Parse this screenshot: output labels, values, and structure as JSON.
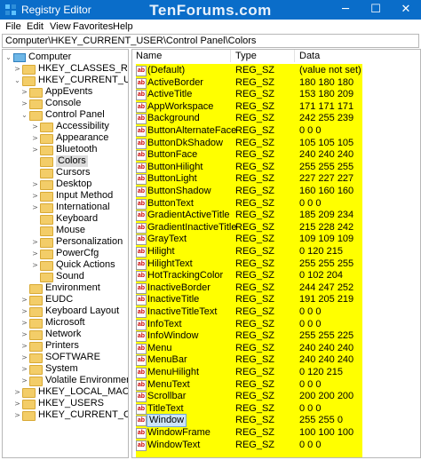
{
  "window": {
    "title": "Registry Editor",
    "watermark": "TenForums.com",
    "controls": {
      "minimize": "─",
      "maximize": "☐",
      "close": "✕"
    }
  },
  "menu": [
    "File",
    "Edit",
    "View",
    "Favorites",
    "Help"
  ],
  "address": "Computer\\HKEY_CURRENT_USER\\Control Panel\\Colors",
  "tree": [
    {
      "label": "Computer",
      "expander": "⌄",
      "icon": "computer"
    },
    {
      "label": "HKEY_CLASSES_ROOT",
      "expander": ">",
      "icon": "folder"
    },
    {
      "label": "HKEY_CURRENT_USER",
      "expander": "⌄",
      "icon": "folder"
    },
    {
      "label": "AppEvents",
      "expander": ">",
      "icon": "folder"
    },
    {
      "label": "Console",
      "expander": ">",
      "icon": "folder"
    },
    {
      "label": "Control Panel",
      "expander": "⌄",
      "icon": "folder"
    },
    {
      "label": "Accessibility",
      "expander": ">",
      "icon": "folder"
    },
    {
      "label": "Appearance",
      "expander": ">",
      "icon": "folder"
    },
    {
      "label": "Bluetooth",
      "expander": ">",
      "icon": "folder"
    },
    {
      "label": "Colors",
      "expander": "",
      "icon": "folder",
      "selected": true
    },
    {
      "label": "Cursors",
      "expander": "",
      "icon": "folder"
    },
    {
      "label": "Desktop",
      "expander": ">",
      "icon": "folder"
    },
    {
      "label": "Input Method",
      "expander": ">",
      "icon": "folder"
    },
    {
      "label": "International",
      "expander": ">",
      "icon": "folder"
    },
    {
      "label": "Keyboard",
      "expander": "",
      "icon": "folder"
    },
    {
      "label": "Mouse",
      "expander": "",
      "icon": "folder"
    },
    {
      "label": "Personalization",
      "expander": ">",
      "icon": "folder"
    },
    {
      "label": "PowerCfg",
      "expander": ">",
      "icon": "folder"
    },
    {
      "label": "Quick Actions",
      "expander": ">",
      "icon": "folder"
    },
    {
      "label": "Sound",
      "expander": "",
      "icon": "folder"
    },
    {
      "label": "Environment",
      "expander": "",
      "icon": "folder"
    },
    {
      "label": "EUDC",
      "expander": ">",
      "icon": "folder"
    },
    {
      "label": "Keyboard Layout",
      "expander": ">",
      "icon": "folder"
    },
    {
      "label": "Microsoft",
      "expander": ">",
      "icon": "folder"
    },
    {
      "label": "Network",
      "expander": ">",
      "icon": "folder"
    },
    {
      "label": "Printers",
      "expander": ">",
      "icon": "folder"
    },
    {
      "label": "SOFTWARE",
      "expander": ">",
      "icon": "folder"
    },
    {
      "label": "System",
      "expander": ">",
      "icon": "folder"
    },
    {
      "label": "Volatile Environment",
      "expander": ">",
      "icon": "folder"
    },
    {
      "label": "HKEY_LOCAL_MACHINE",
      "expander": ">",
      "icon": "folder"
    },
    {
      "label": "HKEY_USERS",
      "expander": ">",
      "icon": "folder"
    },
    {
      "label": "HKEY_CURRENT_CONFIG",
      "expander": ">",
      "icon": "folder"
    }
  ],
  "columns": {
    "name": "Name",
    "type": "Type",
    "data": "Data"
  },
  "values": [
    {
      "name": "(Default)",
      "type": "REG_SZ",
      "data": "(value not set)"
    },
    {
      "name": "ActiveBorder",
      "type": "REG_SZ",
      "data": "180 180 180"
    },
    {
      "name": "ActiveTitle",
      "type": "REG_SZ",
      "data": "153 180 209"
    },
    {
      "name": "AppWorkspace",
      "type": "REG_SZ",
      "data": "171 171 171"
    },
    {
      "name": "Background",
      "type": "REG_SZ",
      "data": "242 255 239"
    },
    {
      "name": "ButtonAlternateFace",
      "type": "REG_SZ",
      "data": "0 0 0"
    },
    {
      "name": "ButtonDkShadow",
      "type": "REG_SZ",
      "data": "105 105 105"
    },
    {
      "name": "ButtonFace",
      "type": "REG_SZ",
      "data": "240 240 240"
    },
    {
      "name": "ButtonHilight",
      "type": "REG_SZ",
      "data": "255 255 255"
    },
    {
      "name": "ButtonLight",
      "type": "REG_SZ",
      "data": "227 227 227"
    },
    {
      "name": "ButtonShadow",
      "type": "REG_SZ",
      "data": "160 160 160"
    },
    {
      "name": "ButtonText",
      "type": "REG_SZ",
      "data": "0 0 0"
    },
    {
      "name": "GradientActiveTitle",
      "type": "REG_SZ",
      "data": "185 209 234"
    },
    {
      "name": "GradientInactiveTitle",
      "type": "REG_SZ",
      "data": "215 228 242"
    },
    {
      "name": "GrayText",
      "type": "REG_SZ",
      "data": "109 109 109"
    },
    {
      "name": "Hilight",
      "type": "REG_SZ",
      "data": "0 120 215"
    },
    {
      "name": "HilightText",
      "type": "REG_SZ",
      "data": "255 255 255"
    },
    {
      "name": "HotTrackingColor",
      "type": "REG_SZ",
      "data": "0 102 204"
    },
    {
      "name": "InactiveBorder",
      "type": "REG_SZ",
      "data": "244 247 252"
    },
    {
      "name": "InactiveTitle",
      "type": "REG_SZ",
      "data": "191 205 219"
    },
    {
      "name": "InactiveTitleText",
      "type": "REG_SZ",
      "data": "0 0 0"
    },
    {
      "name": "InfoText",
      "type": "REG_SZ",
      "data": "0 0 0"
    },
    {
      "name": "InfoWindow",
      "type": "REG_SZ",
      "data": "255 255 225"
    },
    {
      "name": "Menu",
      "type": "REG_SZ",
      "data": "240 240 240"
    },
    {
      "name": "MenuBar",
      "type": "REG_SZ",
      "data": "240 240 240"
    },
    {
      "name": "MenuHilight",
      "type": "REG_SZ",
      "data": "0 120 215"
    },
    {
      "name": "MenuText",
      "type": "REG_SZ",
      "data": "0 0 0"
    },
    {
      "name": "Scrollbar",
      "type": "REG_SZ",
      "data": "200 200 200"
    },
    {
      "name": "TitleText",
      "type": "REG_SZ",
      "data": "0 0 0"
    },
    {
      "name": "Window",
      "type": "REG_SZ",
      "data": "255 255 0",
      "selected": true
    },
    {
      "name": "WindowFrame",
      "type": "REG_SZ",
      "data": "100 100 100"
    },
    {
      "name": "WindowText",
      "type": "REG_SZ",
      "data": "0 0 0"
    }
  ],
  "colors": {
    "titlebar": "#0a6dc9",
    "highlight": "#ffff00",
    "folder": "#f3cd68"
  }
}
